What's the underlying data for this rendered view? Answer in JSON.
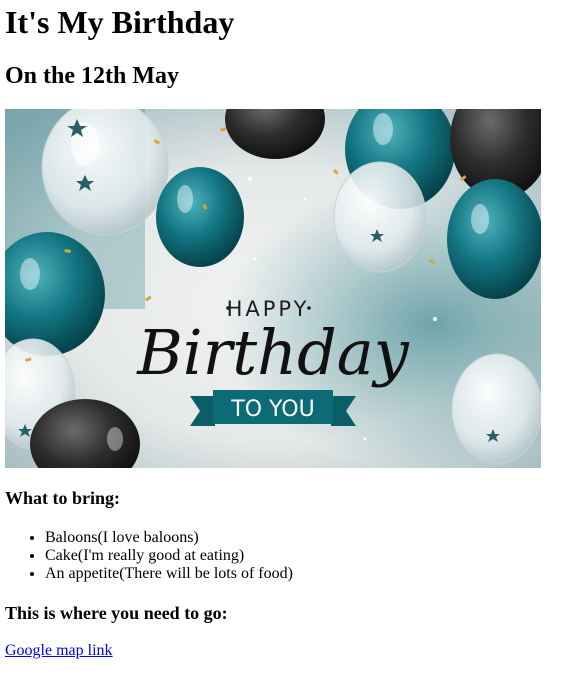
{
  "page": {
    "title": "It's My Birthday",
    "subtitle": "On the 12th May"
  },
  "hero_image": {
    "happy_text": "HAPPY",
    "birthday_text": "Birthday",
    "ribbon_text": "TO YOU",
    "colors": {
      "teal": "#0d6b76",
      "dark": "#2b2b2b",
      "background": "#e9eceb"
    }
  },
  "bring_section": {
    "heading": "What to bring:",
    "items": [
      "Baloons(I love baloons)",
      "Cake(I'm really good at eating)",
      "An appetite(There will be lots of food)"
    ]
  },
  "location_section": {
    "heading": "This is where you need to go:",
    "link_text": "Google map link"
  }
}
